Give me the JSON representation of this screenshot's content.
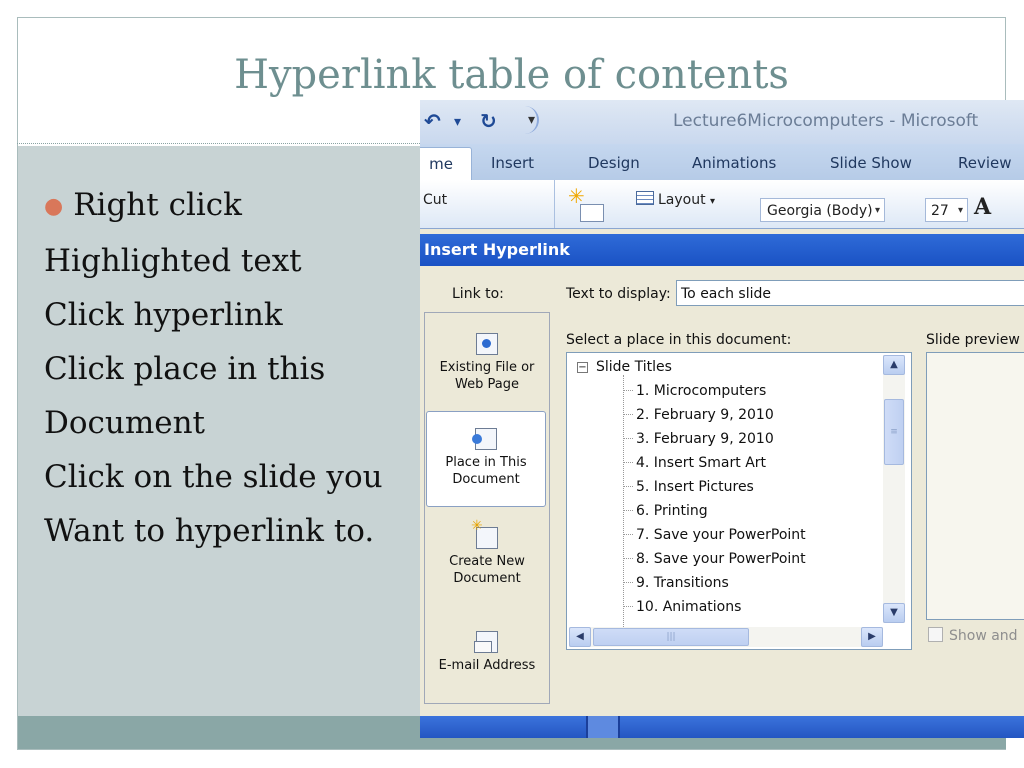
{
  "slide": {
    "title": "Hyperlink table of contents",
    "bullets": [
      "Right click",
      "Highlighted text",
      "Click hyperlink",
      "Click place in this",
      "Document",
      "Click on the slide you",
      "Want to hyperlink to."
    ],
    "colors": {
      "title": "#6e8f90",
      "left_panel": "#c8d3d4",
      "bottom_band": "#8aa7a6",
      "bullet": "#d9775a"
    }
  },
  "app": {
    "window_title": "Lecture6Microcomputers - Microsoft",
    "tabs": [
      "me",
      "Insert",
      "Design",
      "Animations",
      "Slide Show",
      "Review"
    ],
    "ribbon": {
      "cut_label": "Cut",
      "layout_label": "Layout",
      "font_name": "Georgia (Body)",
      "font_size": "27",
      "grow_font": "A"
    }
  },
  "dialog": {
    "title": "Insert Hyperlink",
    "link_to_label": "Link to:",
    "link_to_items": [
      {
        "label_line1": "Existing File or",
        "label_line2": "Web Page",
        "icon": "web-page-icon"
      },
      {
        "label_line1": "Place in This",
        "label_line2": "Document",
        "icon": "document-place-icon",
        "selected": true
      },
      {
        "label_line1": "Create New",
        "label_line2": "Document",
        "icon": "new-document-icon"
      },
      {
        "label_line1": "E-mail Address",
        "label_line2": "",
        "icon": "email-icon"
      }
    ],
    "text_to_display_label": "Text to display:",
    "text_to_display_value": "To each slide",
    "select_place_label": "Select a place in this document:",
    "tree_root": "Slide Titles",
    "tree_items": [
      "1. Microcomputers",
      "2. February 9, 2010",
      "3. February 9, 2010",
      "4. Insert Smart Art",
      "5. Insert Pictures",
      "6. Printing",
      "7. Save your PowerPoint",
      "8. Save your PowerPoint",
      "9. Transitions",
      "10. Animations"
    ],
    "slide_preview_label": "Slide preview",
    "show_checkbox_label": "Show and"
  }
}
